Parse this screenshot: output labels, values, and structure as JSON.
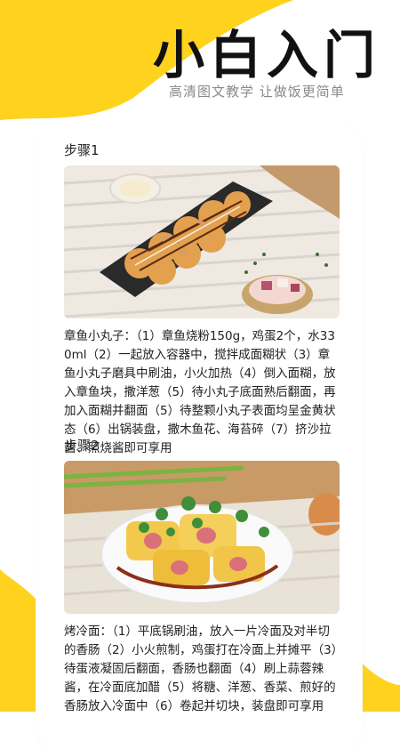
{
  "hero": {
    "title": "小白入门",
    "subtitle": "高清图文教学 让做饭更简单"
  },
  "steps": [
    {
      "title": "步骤1",
      "photo_icon": "takoyaki-photo",
      "text": "章鱼小丸子：（1）章鱼烧粉150g，鸡蛋2个，水330ml（2）一起放入容器中，搅拌成面糊状（3）章鱼小丸子磨具中刷油，小火加热（4）倒入面糊，放入章鱼块，撒洋葱（5）待小丸子底面熟后翻面，再加入面糊并翻面（5）待整颗小丸子表面均呈金黄状态（6）出锅装盘，撒木鱼花、海苔碎（7）挤沙拉酱、照烧酱即可享用"
    },
    {
      "title": "步骤2",
      "photo_icon": "kaolengmian-photo",
      "text": "烤冷面：（1）平底锅刷油，放入一片冷面及对半切的香肠（2）小火煎制，鸡蛋打在冷面上并摊平（3）待蛋液凝固后翻面，香肠也翻面（4）刷上蒜蓉辣酱，在冷面底加醋（5）将糖、洋葱、香菜、煎好的香肠放入冷面中（6）卷起并切块，装盘即可享用"
    }
  ],
  "colors": {
    "accent": "#FFD21E",
    "card": "#FFFFFF",
    "text": "#222222",
    "subtitle": "#8A8A8A"
  }
}
